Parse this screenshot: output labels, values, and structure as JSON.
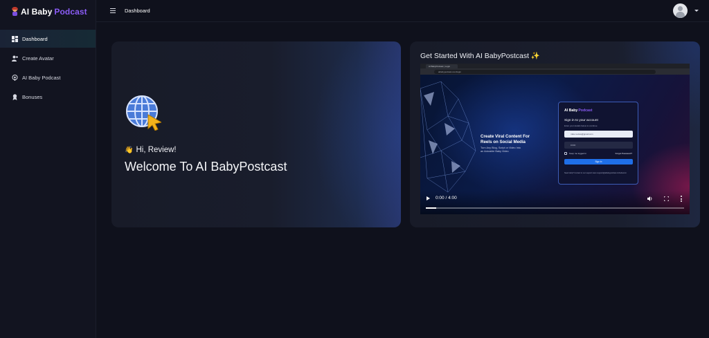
{
  "brand": {
    "name_part1": "AI Baby",
    "name_part2": "Podcast"
  },
  "sidebar": {
    "items": [
      {
        "label": "Dashboard",
        "icon": "dashboard-icon",
        "active": true
      },
      {
        "label": "Create Avatar",
        "icon": "user-plus-icon",
        "active": false
      },
      {
        "label": "AI Baby Podcast",
        "icon": "podcast-icon",
        "active": false
      },
      {
        "label": "Bonuses",
        "icon": "award-icon",
        "active": false
      }
    ]
  },
  "header": {
    "breadcrumb": "Dashboard"
  },
  "welcome": {
    "greeting_emoji": "👋",
    "greeting": "Hi, Review!",
    "title": "Welcome To AI BabyPostcast"
  },
  "video": {
    "title": "Get Started With AI BabyPostcast ✨",
    "browser_tab": "AI BabyPodcast | Login",
    "browser_url": "aibabypodcast.com/login",
    "hero_title": "Create Viral Content For Reels on Social Media",
    "hero_subtitle": "Turn Any Blog, Script or Video Into an Adorable Baby Video",
    "signin": {
      "logo_part1": "AI Baby",
      "logo_part2": "Podcast",
      "heading": "Sign in to your account",
      "subheading": "Enter your details below to continue",
      "email_value": "mike.review@gmail.com",
      "password_value": "••••••",
      "remember_label": "Keep me logged in",
      "forgot_label": "Forgot Password?",
      "button_label": "Sign In",
      "help_text": "Need Help? Contact to our support team   support@aibabypodcast.zohodesk.in"
    },
    "time": "0:00 / 4:00",
    "progress": 0.04
  },
  "colors": {
    "accent": "#8b5cf6",
    "button": "#1f6fe8",
    "background": "#0f111c"
  }
}
